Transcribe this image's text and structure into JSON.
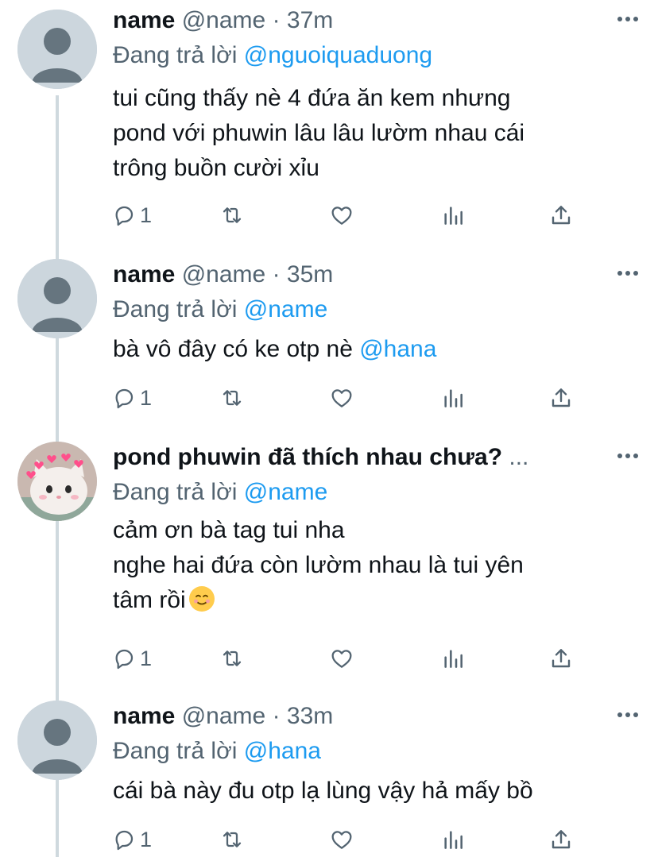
{
  "tweets": [
    {
      "name": "name",
      "handle": "@name",
      "time": "37m",
      "reply_prefix": "Đang trả lời",
      "reply_to": "@nguoiquaduong",
      "lines": [
        "tui cũng thấy nè 4 đứa ăn kem nhưng",
        "pond với phuwin lâu lâu lườm nhau cái",
        "trông buồn cười  xỉu"
      ],
      "replies": "1"
    },
    {
      "name": "name",
      "handle": "@name",
      "time": "35m",
      "reply_prefix": "Đang trả lời",
      "reply_to": "@name",
      "text_before": "bà vô đây có ke otp nè ",
      "text_mention": "@hana",
      "replies": "1"
    },
    {
      "name": "pond phuwin đã thích nhau chưa?",
      "ellipsis": "...",
      "reply_prefix": "Đang trả lời",
      "reply_to": "@name",
      "lines": [
        "cảm ơn bà tag tui nha",
        "nghe hai đứa còn lườm nhau là tui yên",
        "tâm rồi"
      ],
      "emoji": "smiling-face-emoji",
      "replies": "1"
    },
    {
      "name": "name",
      "handle": "@name",
      "time": "33m",
      "reply_prefix": "Đang trả lời",
      "reply_to": "@hana",
      "lines": [
        "cái bà này đu otp lạ lùng vậy hả mấy bồ"
      ],
      "replies": "1"
    }
  ],
  "separator": "·",
  "icons": [
    "reply-icon",
    "retweet-icon",
    "like-icon",
    "analytics-icon",
    "share-icon",
    "more-icon"
  ],
  "colors": {
    "text": "#0f1419",
    "secondary": "#536471",
    "accent": "#1d9bf0",
    "thread_line": "#cfd9de",
    "avatar_default": "#ccd6dd"
  }
}
